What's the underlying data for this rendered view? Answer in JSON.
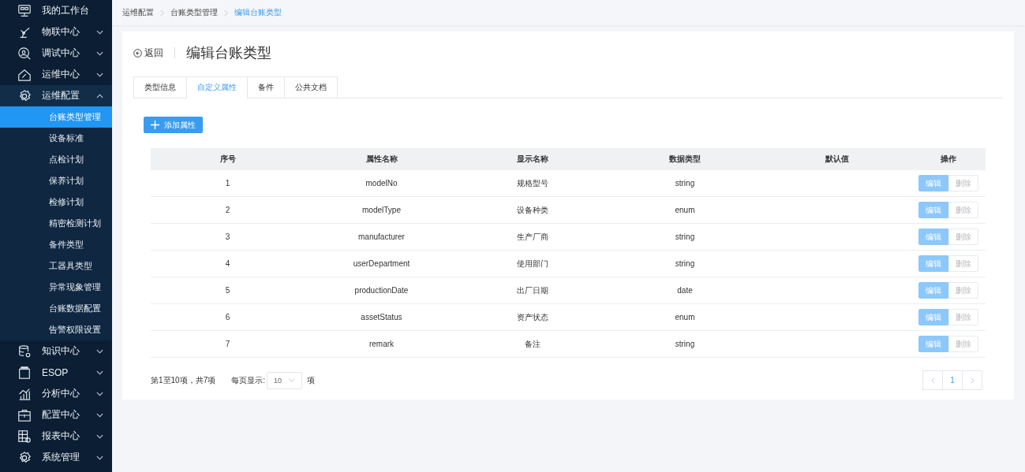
{
  "sidebar": {
    "items": [
      {
        "label": "我的工作台",
        "expandable": false,
        "expanded": false
      },
      {
        "label": "物联中心",
        "expandable": true,
        "expanded": false
      },
      {
        "label": "调试中心",
        "expandable": true,
        "expanded": false
      },
      {
        "label": "运维中心",
        "expandable": true,
        "expanded": false
      },
      {
        "label": "运维配置",
        "expandable": true,
        "expanded": true,
        "children": [
          {
            "label": "台账类型管理",
            "selected": true
          },
          {
            "label": "设备标准",
            "selected": false
          },
          {
            "label": "点检计划",
            "selected": false
          },
          {
            "label": "保养计划",
            "selected": false
          },
          {
            "label": "检修计划",
            "selected": false
          },
          {
            "label": "精密检测计划",
            "selected": false
          },
          {
            "label": "备件类型",
            "selected": false
          },
          {
            "label": "工器具类型",
            "selected": false
          },
          {
            "label": "异常现象管理",
            "selected": false
          },
          {
            "label": "台账数据配置",
            "selected": false
          },
          {
            "label": "告警权限设置",
            "selected": false
          }
        ]
      },
      {
        "label": "知识中心",
        "expandable": true,
        "expanded": false
      },
      {
        "label": "ESOP",
        "expandable": true,
        "expanded": false
      },
      {
        "label": "分析中心",
        "expandable": true,
        "expanded": false
      },
      {
        "label": "配置中心",
        "expandable": true,
        "expanded": false
      },
      {
        "label": "报表中心",
        "expandable": true,
        "expanded": false
      },
      {
        "label": "系统管理",
        "expandable": true,
        "expanded": false
      }
    ]
  },
  "breadcrumb": [
    "运维配置",
    "台账类型管理",
    "编辑台账类型"
  ],
  "header": {
    "back": "返回",
    "title": "编辑台账类型"
  },
  "tabs": [
    {
      "label": "类型信息",
      "selected": false
    },
    {
      "label": "自定义属性",
      "selected": true
    },
    {
      "label": "备件",
      "selected": false
    },
    {
      "label": "公共文档",
      "selected": false
    }
  ],
  "add_button": "添加属性",
  "table": {
    "columns": [
      "序号",
      "属性名称",
      "显示名称",
      "数据类型",
      "默认值",
      "操作"
    ],
    "rows": [
      {
        "cells": [
          "1",
          "modelNo",
          "规格型号",
          "string",
          ""
        ],
        "actions": [
          {
            "label": "编辑",
            "kind": "edit",
            "disabled": true
          },
          {
            "label": "删除",
            "kind": "delete",
            "disabled": true
          }
        ]
      },
      {
        "cells": [
          "2",
          "modelType",
          "设备种类",
          "enum",
          ""
        ],
        "actions": [
          {
            "label": "编辑",
            "kind": "edit",
            "disabled": true
          },
          {
            "label": "删除",
            "kind": "delete",
            "disabled": true
          }
        ]
      },
      {
        "cells": [
          "3",
          "manufacturer",
          "生产厂商",
          "string",
          ""
        ],
        "actions": [
          {
            "label": "编辑",
            "kind": "edit",
            "disabled": true
          },
          {
            "label": "删除",
            "kind": "delete",
            "disabled": true
          }
        ]
      },
      {
        "cells": [
          "4",
          "userDepartment",
          "使用部门",
          "string",
          ""
        ],
        "actions": [
          {
            "label": "编辑",
            "kind": "edit",
            "disabled": true
          },
          {
            "label": "删除",
            "kind": "delete",
            "disabled": true
          }
        ]
      },
      {
        "cells": [
          "5",
          "productionDate",
          "出厂日期",
          "date",
          ""
        ],
        "actions": [
          {
            "label": "编辑",
            "kind": "edit",
            "disabled": true
          },
          {
            "label": "删除",
            "kind": "delete",
            "disabled": true
          }
        ]
      },
      {
        "cells": [
          "6",
          "assetStatus",
          "资产状态",
          "enum",
          ""
        ],
        "actions": [
          {
            "label": "编辑",
            "kind": "edit",
            "disabled": true
          },
          {
            "label": "删除",
            "kind": "delete",
            "disabled": true
          }
        ]
      },
      {
        "cells": [
          "7",
          "remark",
          "备注",
          "string",
          ""
        ],
        "actions": [
          {
            "label": "编辑",
            "kind": "edit",
            "disabled": true
          },
          {
            "label": "删除",
            "kind": "delete",
            "disabled": true
          }
        ]
      }
    ]
  },
  "pagination": {
    "summary": "第1至10项，共7项",
    "per_page_label": "每页显示:",
    "per_page_value": "10",
    "per_page_unit": "项",
    "pages": [
      {
        "label": "1",
        "selected": true
      }
    ]
  }
}
